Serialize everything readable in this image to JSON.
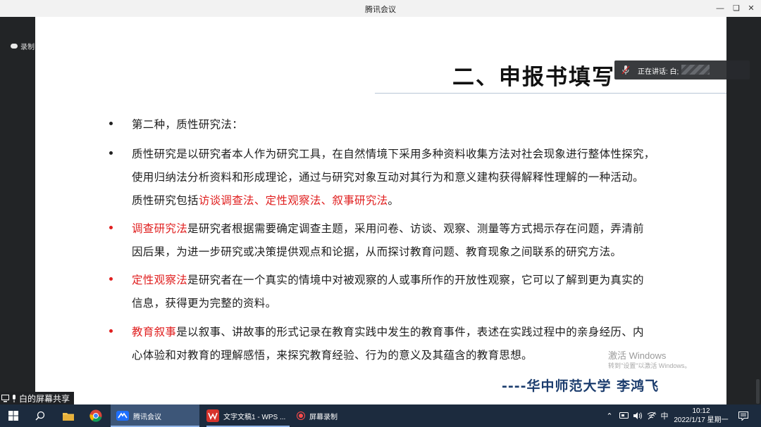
{
  "window": {
    "title": "腾讯会议"
  },
  "recording": {
    "label": "录制中"
  },
  "slide": {
    "title": "二、申报书填写",
    "bullets": [
      {
        "color": "dark",
        "lines": [
          {
            "parts": [
              {
                "text": "第二种，质性研究法：",
                "red": false
              }
            ]
          }
        ]
      },
      {
        "color": "dark",
        "lines": [
          {
            "parts": [
              {
                "text": "质性研究是以研究者本人作为研究工具，在自然情境下采用多种资料收集方法对社会现象进行整体性探究，",
                "red": false
              }
            ]
          },
          {
            "parts": [
              {
                "text": "使用归纳法分析资料和形成理论，通过与研究对象互动对其行为和意义建构获得解释性理解的一种活动。",
                "red": false
              }
            ]
          },
          {
            "parts": [
              {
                "text": "质性研究包括",
                "red": false
              },
              {
                "text": "访谈调查法、定性观察法、叙事研究法",
                "red": true
              },
              {
                "text": "。",
                "red": false
              }
            ]
          }
        ]
      },
      {
        "color": "red",
        "lines": [
          {
            "parts": [
              {
                "text": "调查研究法",
                "red": true
              },
              {
                "text": "是研究者根据需要确定调查主题，采用问卷、访谈、观察、测量等方式揭示存在问题，弄清前",
                "red": false
              }
            ]
          },
          {
            "parts": [
              {
                "text": "因后果，为进一步研究或决策提供观点和论据，从而探讨教育问题、教育现象之间联系的研究方法。",
                "red": false
              }
            ]
          }
        ]
      },
      {
        "color": "red",
        "lines": [
          {
            "parts": [
              {
                "text": "定性观察法",
                "red": true
              },
              {
                "text": "是研究者在一个真实的情境中对被观察的人或事所作的开放性观察，它可以了解到更为真实的",
                "red": false
              }
            ]
          },
          {
            "parts": [
              {
                "text": "信息，获得更为完整的资料。",
                "red": false
              }
            ]
          }
        ]
      },
      {
        "color": "red",
        "lines": [
          {
            "parts": [
              {
                "text": "教育叙事",
                "red": true
              },
              {
                "text": "是以叙事、讲故事的形式记录在教育实践中发生的教育事件，表述在实践过程中的亲身经历、内",
                "red": false
              }
            ]
          },
          {
            "parts": [
              {
                "text": "心体验和对教育的理解感悟，来探究教育经验、行为的意义及其蕴含的教育思想。",
                "red": false
              }
            ]
          }
        ]
      }
    ],
    "signature": "----华中师范大学  李鸿飞",
    "watermark_title": "激活 Windows",
    "watermark_sub": "转到\"设置\"以激活 Windows。"
  },
  "speaking": {
    "label": "正在讲话: 白;"
  },
  "share": {
    "label": "白的屏幕共享"
  },
  "taskbar": {
    "apps": [
      {
        "label": "腾讯会议",
        "icon": "tencent-meeting-icon",
        "active": true
      },
      {
        "label": "文字文稿1 - WPS ...",
        "icon": "wps-icon",
        "active": false
      },
      {
        "label": "屏幕录制",
        "icon": "screen-record-icon",
        "active": false
      }
    ],
    "ime": "中",
    "time": "10:12",
    "date": "2022/1/17 星期一"
  },
  "colors": {
    "accent_red": "#e02020",
    "signature_blue": "#1c3d6e",
    "taskbar": "#1c2b3e"
  }
}
